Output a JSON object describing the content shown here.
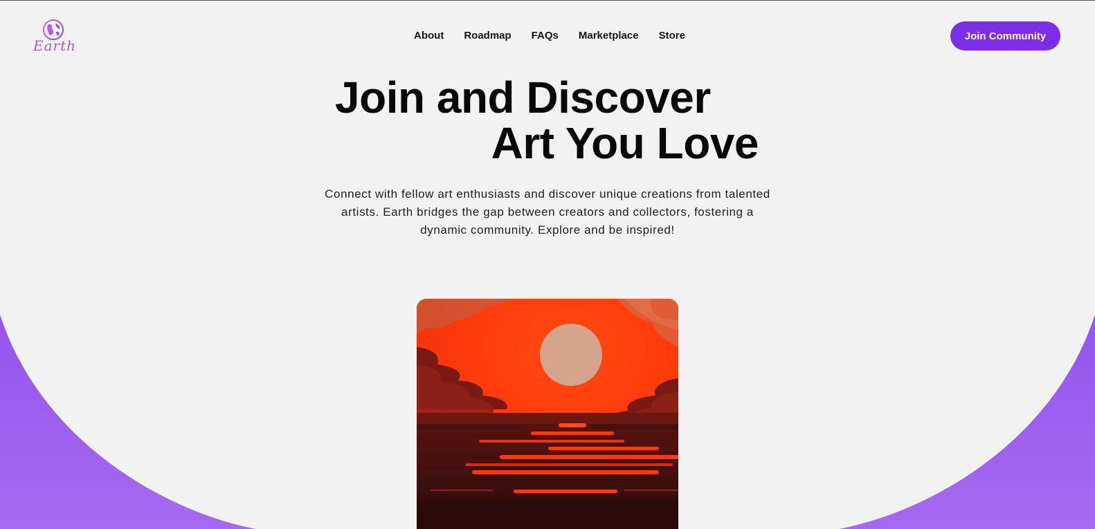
{
  "brand": {
    "logo_text": "Earth",
    "accent_color": "#7b2de8",
    "wave_color": "#9b5ff0"
  },
  "nav": {
    "items": [
      {
        "label": "About"
      },
      {
        "label": "Roadmap"
      },
      {
        "label": "FAQs"
      },
      {
        "label": "Marketplace"
      },
      {
        "label": "Store"
      }
    ]
  },
  "header": {
    "cta_label": "Join Community"
  },
  "hero": {
    "title_line1": "Join and Discover",
    "title_line2": "Art You Love",
    "description": "Connect with fellow art enthusiasts and discover unique creations from talented artists. Earth bridges the gap between creators and collectors, fostering a dynamic community. Explore and be inspired!",
    "image_subject": "sunset-over-sea-artwork"
  }
}
